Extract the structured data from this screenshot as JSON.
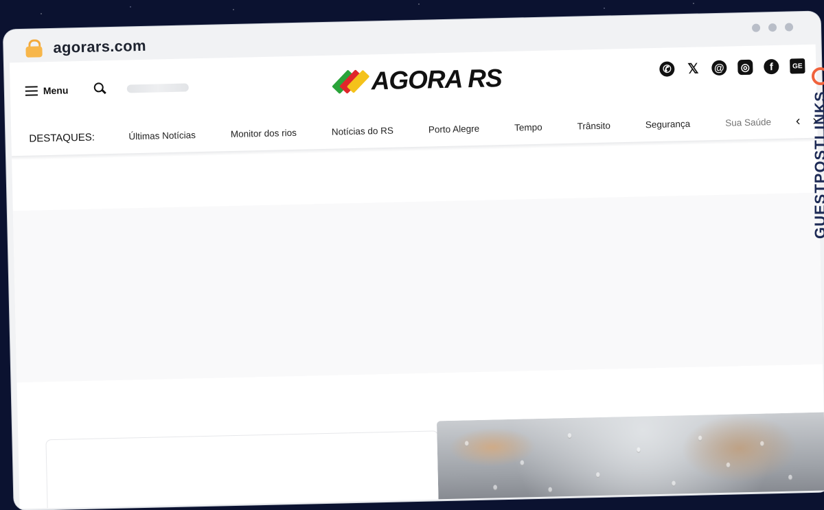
{
  "browser": {
    "url": "agorars.com"
  },
  "header": {
    "menu_label": "Menu",
    "logo_text": "AGORA RS",
    "social_icons": [
      "whatsapp-icon",
      "x-icon",
      "threads-icon",
      "instagram-icon",
      "facebook-icon",
      "google-news-icon"
    ],
    "social_glyphs": {
      "whatsapp": "✆",
      "x": "𝕏",
      "threads": "@",
      "instagram": "◎",
      "facebook": "f",
      "gnews": "GE"
    }
  },
  "nav": {
    "label": "DESTAQUES:",
    "items": [
      "Últimas Notícias",
      "Monitor dos rios",
      "Notícias do RS",
      "Porto Alegre",
      "Tempo",
      "Trânsito",
      "Segurança",
      "Sua Saúde"
    ],
    "prev_glyph": "‹",
    "next_glyph": "›"
  },
  "watermark": {
    "text": "GUESTPOSTLINKS"
  },
  "colors": {
    "logo_green": "#2aa43a",
    "logo_red": "#e0262b",
    "logo_yellow": "#f4c21b",
    "watermark_orange": "#f0623c",
    "watermark_navy": "#1d2a55"
  }
}
